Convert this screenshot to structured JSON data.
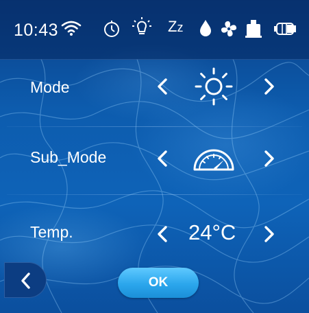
{
  "status_bar": {
    "time": "10:43",
    "icons": [
      "wifi-icon",
      "timer-icon",
      "light-icon",
      "sleep-icon",
      "water-drop-icon",
      "fan-icon",
      "heater-icon",
      "battery-icon"
    ],
    "sleep_z_big": "Z",
    "sleep_z_small": "z"
  },
  "rows": {
    "mode": {
      "label": "Mode",
      "icon": "sun-icon"
    },
    "sub_mode": {
      "label": "Sub_Mode",
      "icon": "speedometer-icon"
    },
    "temp": {
      "label": "Temp.",
      "value": "24°C"
    }
  },
  "footer": {
    "back_icon": "chevron-left-icon",
    "ok_label": "OK"
  },
  "colors": {
    "background": "#0d5cae",
    "status_bar": "#06265c",
    "ok_button": "#2ba6ec",
    "back_button": "#0c3d82"
  }
}
